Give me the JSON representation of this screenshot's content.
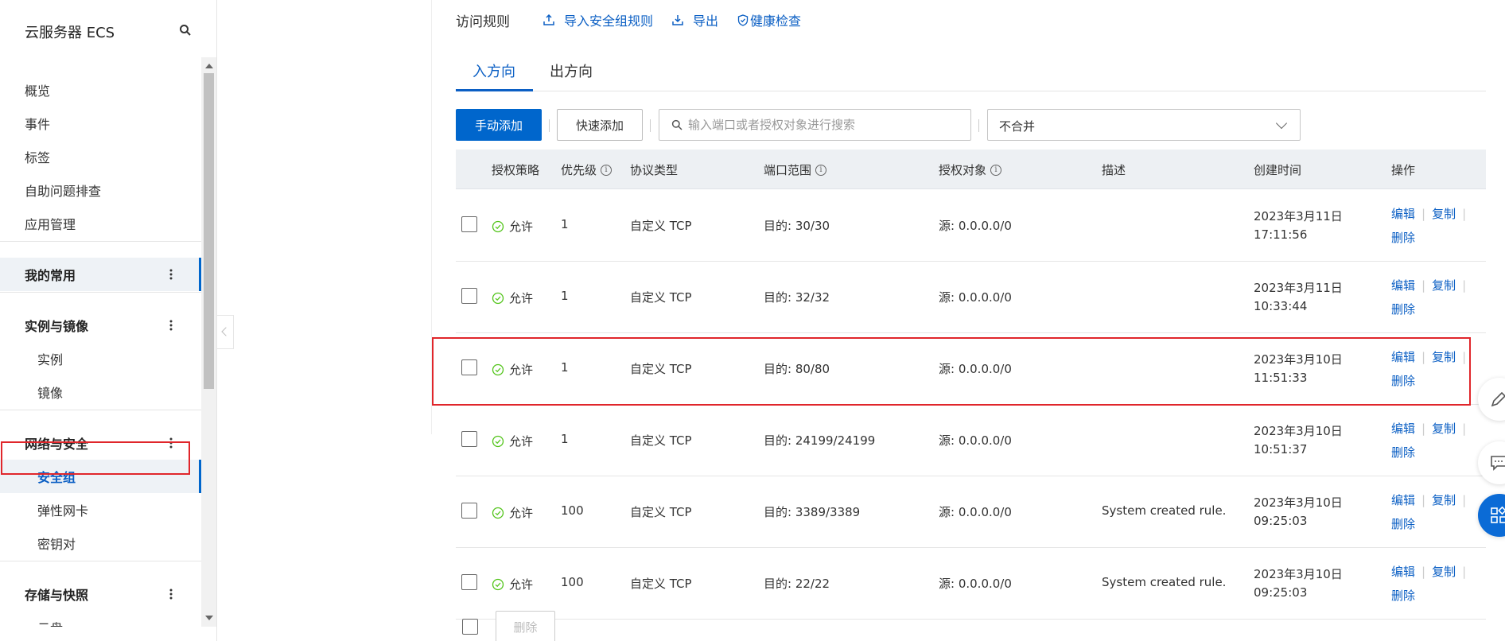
{
  "sidebar": {
    "title": "云服务器 ECS",
    "items": [
      {
        "label": "概览",
        "type": "item"
      },
      {
        "label": "事件",
        "type": "item"
      },
      {
        "label": "标签",
        "type": "item"
      },
      {
        "label": "自助问题排查",
        "type": "item"
      },
      {
        "label": "应用管理",
        "type": "item"
      },
      {
        "label": "我的常用",
        "type": "group"
      },
      {
        "label": "实例与镜像",
        "type": "group"
      },
      {
        "label": "实例",
        "type": "sub"
      },
      {
        "label": "镜像",
        "type": "sub"
      },
      {
        "label": "网络与安全",
        "type": "group"
      },
      {
        "label": "安全组",
        "type": "sub",
        "active": true
      },
      {
        "label": "弹性网卡",
        "type": "sub"
      },
      {
        "label": "密钥对",
        "type": "sub"
      },
      {
        "label": "存储与快照",
        "type": "group"
      },
      {
        "label": "云盘",
        "type": "sub"
      }
    ]
  },
  "header": {
    "title": "访问规则",
    "import_link": "导入安全组规则",
    "export_link": "导出",
    "health_link": "健康检查"
  },
  "tabs": [
    {
      "label": "入方向",
      "active": true
    },
    {
      "label": "出方向",
      "active": false
    }
  ],
  "toolbar": {
    "manual_add": "手动添加",
    "quick_add": "快速添加",
    "search_placeholder": "输入端口或者授权对象进行搜索",
    "merge_select": "不合并"
  },
  "table": {
    "columns": [
      "授权策略",
      "优先级",
      "协议类型",
      "端口范围",
      "授权对象",
      "描述",
      "创建时间",
      "操作"
    ],
    "rows": [
      {
        "policy": "允许",
        "priority": "1",
        "protocol": "自定义 TCP",
        "port": "目的: 30/30",
        "source": "源: 0.0.0.0/0",
        "desc": "",
        "date": "2023年3月11日",
        "time": "17:11:56"
      },
      {
        "policy": "允许",
        "priority": "1",
        "protocol": "自定义 TCP",
        "port": "目的: 32/32",
        "source": "源: 0.0.0.0/0",
        "desc": "",
        "date": "2023年3月11日",
        "time": "10:33:44"
      },
      {
        "policy": "允许",
        "priority": "1",
        "protocol": "自定义 TCP",
        "port": "目的: 80/80",
        "source": "源: 0.0.0.0/0",
        "desc": "",
        "date": "2023年3月10日",
        "time": "11:51:33"
      },
      {
        "policy": "允许",
        "priority": "1",
        "protocol": "自定义 TCP",
        "port": "目的: 24199/24199",
        "source": "源: 0.0.0.0/0",
        "desc": "",
        "date": "2023年3月10日",
        "time": "10:51:37"
      },
      {
        "policy": "允许",
        "priority": "100",
        "protocol": "自定义 TCP",
        "port": "目的: 3389/3389",
        "source": "源: 0.0.0.0/0",
        "desc": "System created rule.",
        "date": "2023年3月10日",
        "time": "09:25:03"
      },
      {
        "policy": "允许",
        "priority": "100",
        "protocol": "自定义 TCP",
        "port": "目的: 22/22",
        "source": "源: 0.0.0.0/0",
        "desc": "System created rule.",
        "date": "2023年3月10日",
        "time": "09:25:03"
      }
    ],
    "ops": {
      "edit": "编辑",
      "copy": "复制",
      "delete": "删除"
    }
  },
  "footer": {
    "delete_button": "删除"
  },
  "colors": {
    "accent": "#0066cc",
    "link": "#0b5fc4",
    "highlight": "#e0262b",
    "allow": "#52c41a"
  }
}
